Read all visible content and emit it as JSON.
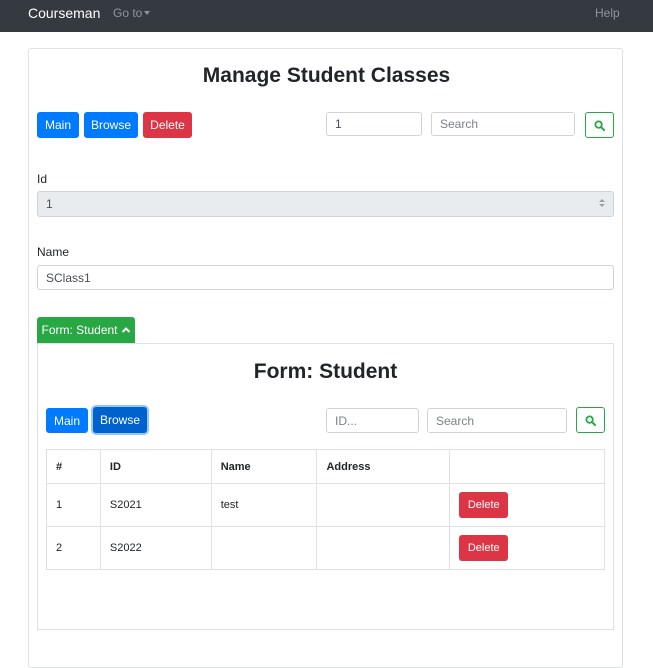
{
  "navbar": {
    "brand": "Courseman",
    "goto_label": "Go to",
    "help_label": "Help"
  },
  "page": {
    "title": "Manage Student Classes"
  },
  "toolbar": {
    "main_label": "Main",
    "browse_label": "Browse",
    "delete_label": "Delete",
    "id_value": "1",
    "search_placeholder": "Search"
  },
  "form": {
    "id_label": "Id",
    "id_value": "1",
    "name_label": "Name",
    "name_value": "SClass1"
  },
  "subform": {
    "toggle_label": "Form: Student",
    "title": "Form: Student",
    "main_label": "Main",
    "browse_label": "Browse",
    "id_placeholder": "ID...",
    "search_placeholder": "Search",
    "columns": [
      "#",
      "ID",
      "Name",
      "Address",
      ""
    ],
    "rows": [
      {
        "num": "1",
        "id": "S2021",
        "name": "test",
        "address": "",
        "delete_label": "Delete"
      },
      {
        "num": "2",
        "id": "S2022",
        "name": "",
        "address": "",
        "delete_label": "Delete"
      }
    ]
  },
  "colors": {
    "navbar": "#343a40",
    "primary": "#007bff",
    "danger": "#dc3545",
    "success": "#28a745"
  },
  "icons": {
    "search": "magnifier-icon",
    "toggle": "chevron-up-icon",
    "dropdown": "caret-down-icon"
  }
}
